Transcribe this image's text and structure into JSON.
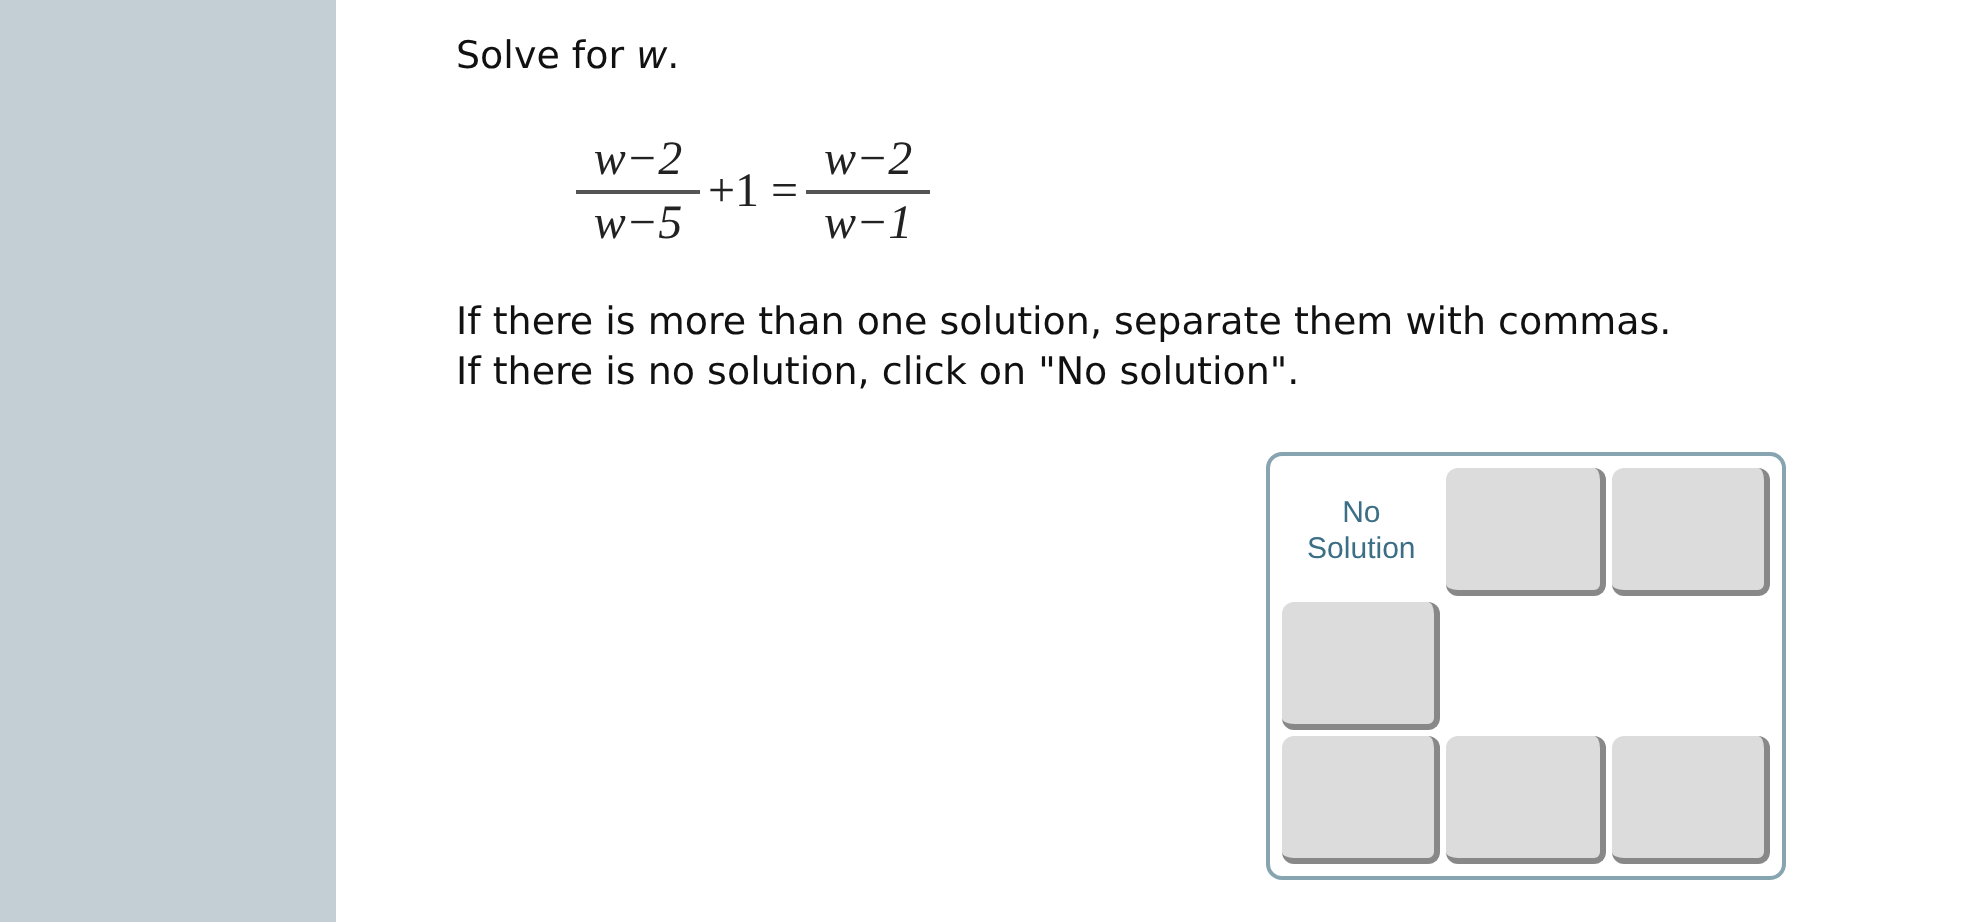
{
  "prompt": "Solve for *w*.",
  "equation": {
    "lhs": {
      "numerator": "w−2",
      "denominator": "w−5"
    },
    "middle": "+1 =",
    "rhs": {
      "numerator": "w−2",
      "denominator": "w−1"
    }
  },
  "instructions": [
    "If there is more than one solution, separate them with commas.",
    "If there is no solution, click on \"No solution\"."
  ],
  "keypad": {
    "rows": [
      [
        {
          "kind": "label",
          "text": "No Solution"
        },
        {
          "kind": "key"
        },
        {
          "kind": "key"
        }
      ],
      [
        {
          "kind": "key"
        }
      ],
      [
        {
          "kind": "key"
        },
        {
          "kind": "key"
        },
        {
          "kind": "key"
        }
      ]
    ]
  }
}
